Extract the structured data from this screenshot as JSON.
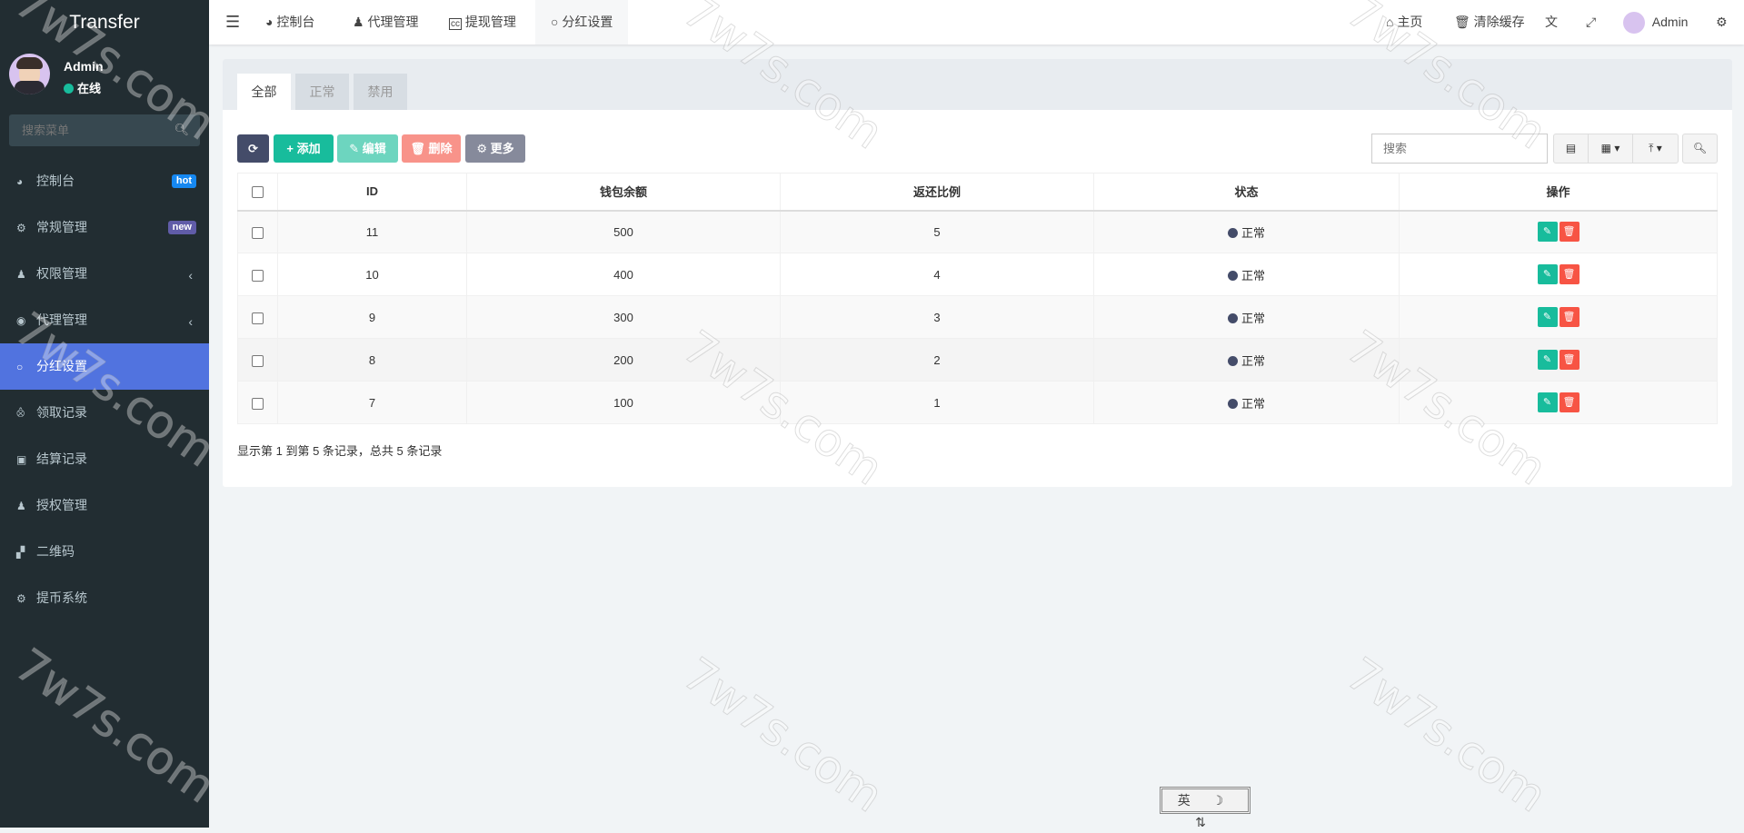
{
  "app": {
    "title": "Transfer"
  },
  "user": {
    "name": "Admin",
    "status": "在线"
  },
  "sidebar": {
    "search_placeholder": "搜索菜单",
    "items": [
      {
        "label": "控制台",
        "icon": "dashboard-icon",
        "badge": "hot",
        "badge_color": "#1688f1"
      },
      {
        "label": "常规管理",
        "icon": "cogs-icon",
        "badge": "new",
        "badge_color": "#605ca8"
      },
      {
        "label": "权限管理",
        "icon": "users-icon",
        "chevron": true
      },
      {
        "label": "代理管理",
        "icon": "user-circle-icon",
        "chevron": true
      },
      {
        "label": "分红设置",
        "icon": "circle-icon",
        "active": true
      },
      {
        "label": "领取记录",
        "icon": "birthday-cake-icon"
      },
      {
        "label": "结算记录",
        "icon": "cc-icon"
      },
      {
        "label": "授权管理",
        "icon": "users-icon"
      },
      {
        "label": "二维码",
        "icon": "qrcode-icon"
      },
      {
        "label": "提币系统",
        "icon": "gear-icon"
      }
    ]
  },
  "header": {
    "tabs": [
      {
        "label": "控制台",
        "icon": "dashboard-icon"
      },
      {
        "label": "代理管理",
        "icon": "user-icon"
      },
      {
        "label": "提现管理",
        "icon": "cc-icon"
      },
      {
        "label": "分红设置",
        "icon": "circle-icon",
        "active": true
      }
    ],
    "right": {
      "home": "主页",
      "clear_cache": "清除缓存",
      "user": "Admin"
    }
  },
  "panel": {
    "tabs": [
      "全部",
      "正常",
      "禁用"
    ],
    "toolbar": {
      "add": "添加",
      "edit": "编辑",
      "delete": "删除",
      "more": "更多"
    },
    "search_placeholder": "搜索",
    "columns": [
      "ID",
      "钱包余额",
      "返还比例",
      "状态",
      "操作"
    ],
    "rows": [
      {
        "id": "11",
        "balance": "500",
        "ratio": "5",
        "status": "正常"
      },
      {
        "id": "10",
        "balance": "400",
        "ratio": "4",
        "status": "正常"
      },
      {
        "id": "9",
        "balance": "300",
        "ratio": "3",
        "status": "正常"
      },
      {
        "id": "8",
        "balance": "200",
        "ratio": "2",
        "status": "正常"
      },
      {
        "id": "7",
        "balance": "100",
        "ratio": "1",
        "status": "正常"
      }
    ],
    "footer": "显示第 1 到第 5 条记录，总共 5 条记录"
  },
  "ime": {
    "label": "英 ☽ ⇅"
  },
  "watermark": "7w7s.com",
  "colors": {
    "sidebar": "#222d32",
    "active": "#5173df",
    "success": "#18bc9c",
    "danger": "#f75444",
    "primary_dark": "#444c69"
  }
}
